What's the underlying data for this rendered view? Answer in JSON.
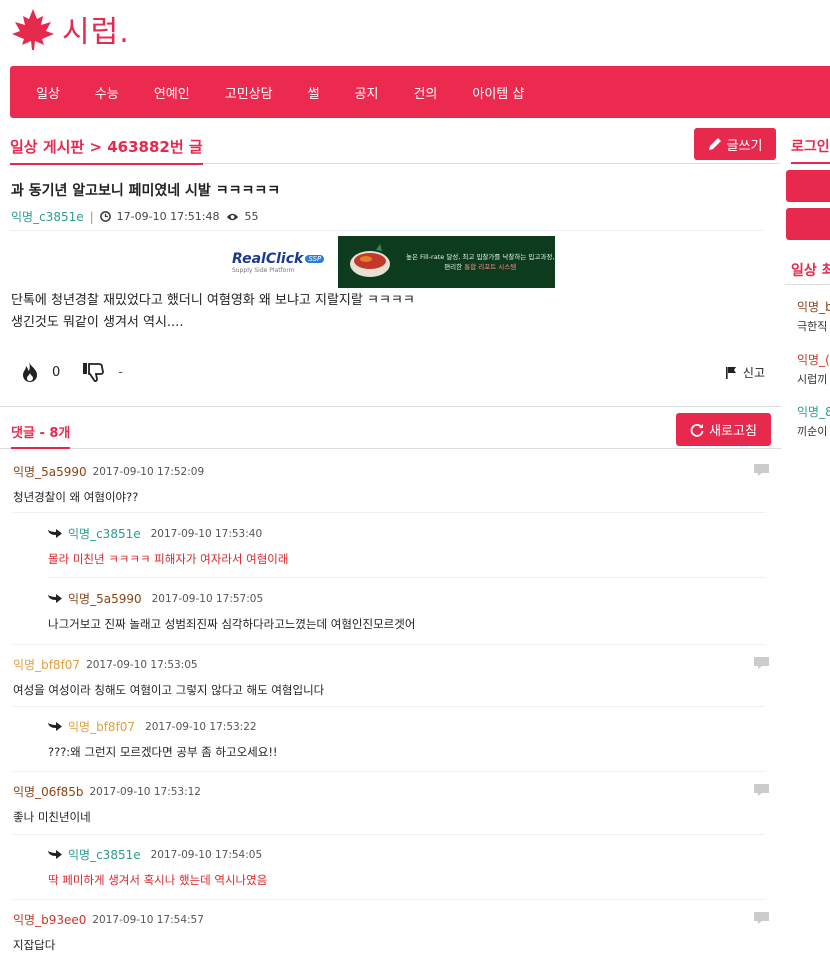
{
  "brand": {
    "logo_text": "시럽.",
    "color": "#e8294e"
  },
  "nav": {
    "items": [
      "일상",
      "수능",
      "연예인",
      "고민상담",
      "썰",
      "공지",
      "건의",
      "아이템 샵"
    ]
  },
  "board": {
    "title": "일상 게시판 > 463882번 글",
    "write_label": "글쓰기"
  },
  "post": {
    "title": "과 동기년 알고보니 페미였네 시발 ㅋㅋㅋㅋㅋ",
    "author": "익명_c3851e",
    "datetime": "17-09-10 17:51:48",
    "views": "55",
    "body_lines": [
      "단톡에 청년경찰 재밌었다고 했더니 여혐영화 왜 보냐고 지랄지랄 ㅋㅋㅋㅋ",
      "생긴것도 뭐같이 생겨서 역시...."
    ],
    "likes": "0",
    "dislikes": "-",
    "report_label": "신고"
  },
  "ad": {
    "logo_main": "RealClick",
    "logo_badge": "SSP",
    "logo_sub": "Supply Side Platform",
    "text_line1": "높은 Fill-rate 달성, 최고 입찰가를 낙찰하는 입고과정,",
    "text_line2_a": "편리한 ",
    "text_line2_b": "통합 리포트 시스템"
  },
  "comments_section": {
    "title": "댓글 - 8개",
    "refresh_label": "새로고침"
  },
  "comments": [
    {
      "author": "익명_5a5990",
      "date": "2017-09-10 17:52:09",
      "text": "청년경찰이 왜 여혐이야??"
    },
    {
      "author": "익명_c3851e",
      "date": "2017-09-10 17:53:40",
      "text": "몰라 미친년 ㅋㅋㅋㅋ 피해자가 여자라서 여혐이래"
    },
    {
      "author": "익명_5a5990",
      "date": "2017-09-10 17:57:05",
      "text": "나그거보고 진짜 놀래고 성범죄진짜 심각하다라고느꼈는데 여혐인진모르겟어"
    },
    {
      "author": "익명_bf8f07",
      "date": "2017-09-10 17:53:05",
      "text": "여성을 여성이라 칭해도 여혐이고 그렇지 않다고 해도 여혐입니다"
    },
    {
      "author": "익명_bf8f07",
      "date": "2017-09-10 17:53:22",
      "text": "???:왜 그런지 모르겠다면 공부 좀 하고오세요!!"
    },
    {
      "author": "익명_06f85b",
      "date": "2017-09-10 17:53:12",
      "text": "좋나 미친년이네"
    },
    {
      "author": "익명_c3851e",
      "date": "2017-09-10 17:54:05",
      "text": "딱 페미하게 생겨서 혹시나 했는데 역시나였음"
    },
    {
      "author": "익명_b93ee0",
      "date": "2017-09-10 17:54:57",
      "text": "지잡답다"
    }
  ],
  "sidebar": {
    "login_title": "로그인",
    "section_title": "일상 최",
    "items": [
      {
        "author": "익명_b",
        "text": "극한직"
      },
      {
        "author": "익명_(",
        "text": "시럽끼"
      },
      {
        "author": "익명_8",
        "text": "끼순이"
      }
    ]
  },
  "colors": {
    "accent": "#e8294e",
    "author_c3851e": "#2a9d8f",
    "author_5a5990": "#8b4513",
    "author_bf8f07": "#e0a040",
    "author_06f85b": "#8b4513",
    "author_b93ee0": "#c0392b",
    "reply_red": "#d9262b"
  }
}
